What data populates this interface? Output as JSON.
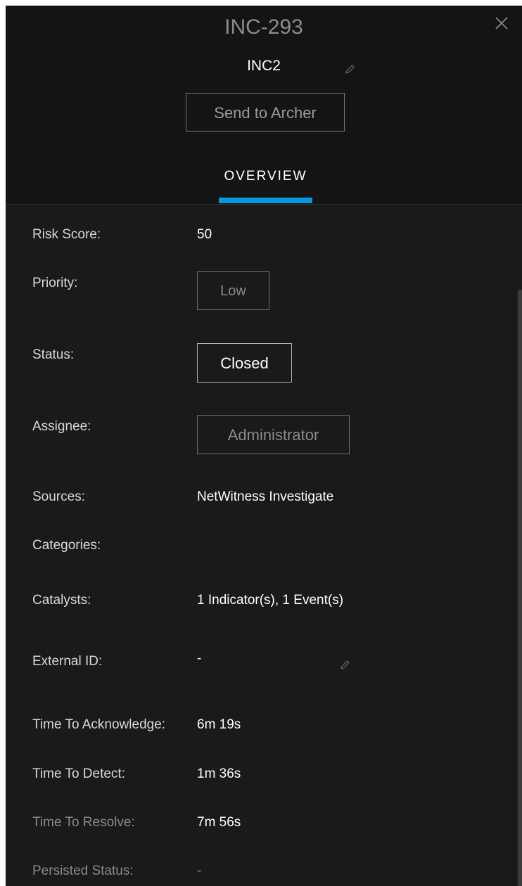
{
  "header": {
    "incident_id": "INC-293",
    "incident_name": "INC2",
    "send_button": "Send to Archer",
    "tab": "OVERVIEW"
  },
  "fields": {
    "risk_score": {
      "label": "Risk Score:",
      "value": "50"
    },
    "priority": {
      "label": "Priority:",
      "value": "Low"
    },
    "status": {
      "label": "Status:",
      "value": "Closed"
    },
    "assignee": {
      "label": "Assignee:",
      "value": "Administrator"
    },
    "sources": {
      "label": "Sources:",
      "value": "NetWitness Investigate"
    },
    "categories": {
      "label": "Categories:",
      "value": ""
    },
    "catalysts": {
      "label": "Catalysts:",
      "value": "1 Indicator(s), 1 Event(s)"
    },
    "external_id": {
      "label": "External ID:",
      "value": "-"
    },
    "time_to_acknowledge": {
      "label": "Time To Acknowledge:",
      "value": "6m 19s"
    },
    "time_to_detect": {
      "label": "Time To Detect:",
      "value": "1m 36s"
    },
    "time_to_resolve": {
      "label": "Time To Resolve:",
      "value": "7m 56s"
    },
    "persisted_status": {
      "label": "Persisted Status:",
      "value": "-"
    }
  },
  "icons": {
    "close": "close-icon",
    "edit": "pencil-icon"
  },
  "colors": {
    "accent": "#0b95dd",
    "panel_background": "#1a1a1a",
    "header_background": "#141414"
  }
}
